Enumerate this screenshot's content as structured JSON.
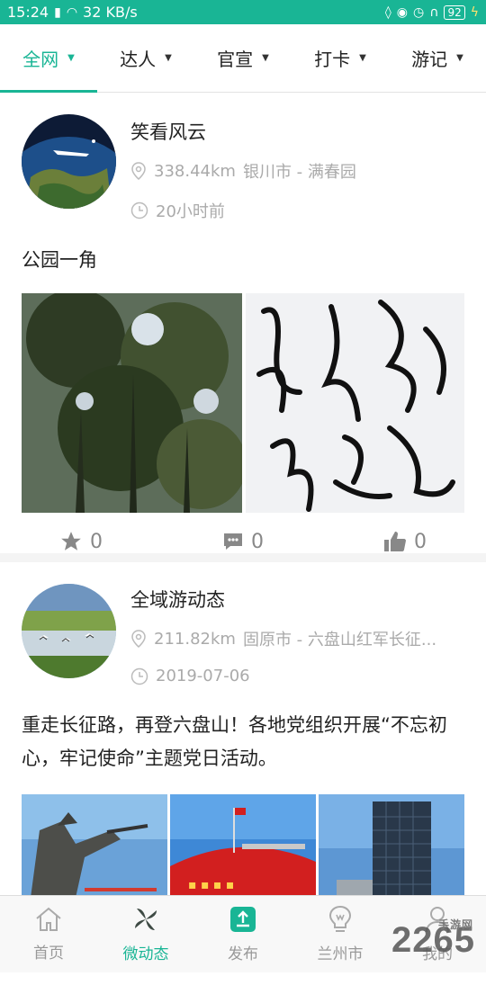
{
  "status_bar": {
    "time": "15:24",
    "network": "4G",
    "speed": "32 KB/s",
    "battery": "92"
  },
  "tabs": [
    {
      "label": "全网",
      "active": true
    },
    {
      "label": "达人"
    },
    {
      "label": "官宣"
    },
    {
      "label": "打卡"
    },
    {
      "label": "游记"
    }
  ],
  "posts": [
    {
      "author": "笑看风云",
      "distance": "338.44km",
      "location": "银川市 - 满春园",
      "time": "20小时前",
      "text": "公园一角",
      "favorites": "0",
      "comments": "0",
      "likes": "0"
    },
    {
      "author": "全域游动态",
      "distance": "211.82km",
      "location": "固原市 - 六盘山红军长征...",
      "time": "2019-07-06",
      "text": "重走长征路，再登六盘山！各地党组织开展“不忘初心，牢记使命”主题党日活动。"
    }
  ],
  "bottom_nav": [
    {
      "label": "首页",
      "icon": "home-icon"
    },
    {
      "label": "微动态",
      "icon": "pinwheel-icon",
      "active": true
    },
    {
      "label": "发布",
      "icon": "upload-icon"
    },
    {
      "label": "兰州市",
      "icon": "lightbulb-icon"
    },
    {
      "label": "我的",
      "icon": "user-icon"
    }
  ],
  "watermark": {
    "text": "2265",
    "sub": "手游网"
  },
  "colors": {
    "accent": "#19b595"
  }
}
